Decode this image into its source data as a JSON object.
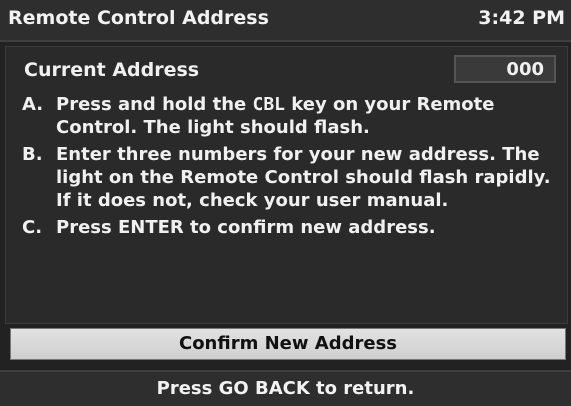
{
  "header": {
    "title": "Remote Control Address",
    "clock": "3:42 PM"
  },
  "address": {
    "label": "Current Address",
    "value": "000"
  },
  "steps": [
    {
      "letter": "A.",
      "pre": "Press and hold the ",
      "key": "CBL",
      "post": " key on your Remote Control.  The light should flash."
    },
    {
      "letter": "B.",
      "text": "Enter three numbers for your new address. The light on the Remote Control should flash rapidly.  If it does not, check your user manual."
    },
    {
      "letter": "C.",
      "text": "Press ENTER to confirm new address."
    }
  ],
  "confirm_button": {
    "label": "Confirm New Address"
  },
  "footer": {
    "text": "Press GO BACK to return."
  }
}
